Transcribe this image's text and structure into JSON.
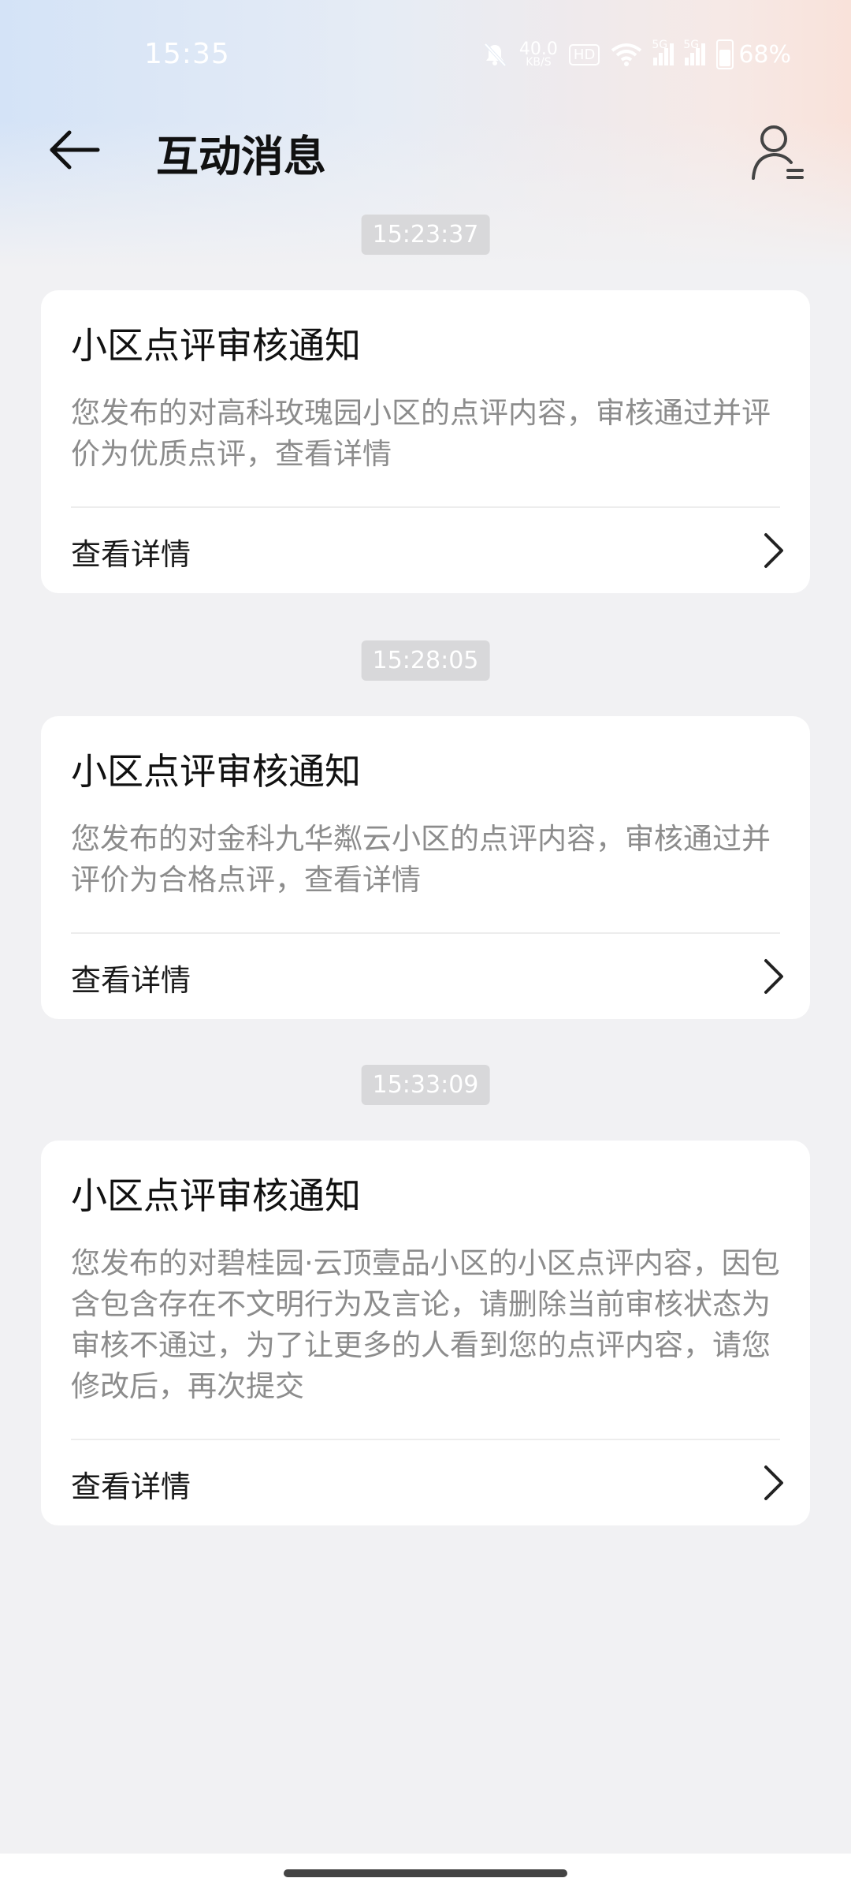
{
  "status": {
    "time": "15:35",
    "net_speed_value": "40.0",
    "net_speed_unit": "KB/S",
    "hd_badge": "HD",
    "signal1_label": "5G",
    "signal2_label": "5G",
    "battery": "68%"
  },
  "header": {
    "title": "互动消息"
  },
  "messages": [
    {
      "time": "15:23:37",
      "title": "小区点评审核通知",
      "body": "您发布的对高科玫瑰园小区的点评内容，审核通过并评价为优质点评，查看详情",
      "action": "查看详情"
    },
    {
      "time": "15:28:05",
      "title": "小区点评审核通知",
      "body": "您发布的对金科九华粼云小区的点评内容，审核通过并评价为合格点评，查看详情",
      "action": "查看详情"
    },
    {
      "time": "15:33:09",
      "title": "小区点评审核通知",
      "body": "您发布的对碧桂园·云顶壹品小区的小区点评内容，因包含包含存在不文明行为及言论，请删除当前审核状态为审核不通过，为了让更多的人看到您的点评内容，请您修改后，再次提交",
      "action": "查看详情"
    }
  ],
  "icons": {
    "back": "arrow-left-icon",
    "profile": "user-icon",
    "chevron": "chevron-right-icon"
  }
}
